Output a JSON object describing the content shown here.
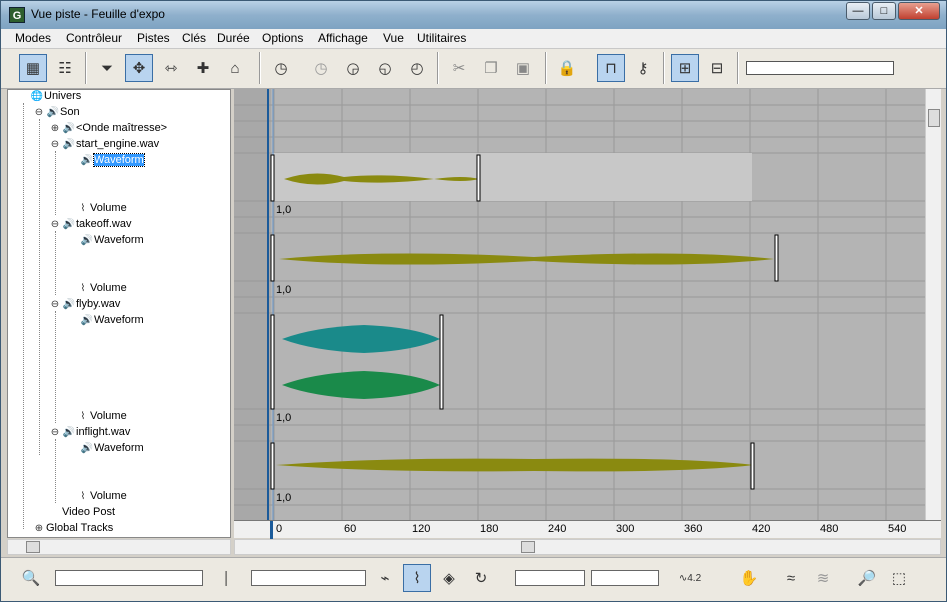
{
  "window": {
    "title": "Vue piste - Feuille d'expo",
    "app_icon": "G",
    "buttons": [
      "—",
      "□",
      "✕"
    ]
  },
  "menu": [
    "Modes",
    "Contrôleur",
    "Pistes",
    "Clés",
    "Durée",
    "Options",
    "Affichage",
    "Vue",
    "Utilitaires"
  ],
  "toolbar": {
    "icons": [
      "filter-icon",
      "edit-keys-icon",
      "filters-funnel-icon",
      "move-keys-icon",
      "slide-keys-icon",
      "add-keys-icon",
      "scale-keys-icon",
      "insert-time-icon",
      "select-time-icon",
      "delete-time-icon",
      "reverse-time-icon",
      "scale-time-icon",
      "cut-icon",
      "copy-icon",
      "paste-icon",
      "lock-selection-icon",
      "snap-frames-icon",
      "show-keyable-icon",
      "modify-subtree-icon",
      "modify-child-keys-icon"
    ]
  },
  "tree": {
    "items": [
      {
        "label": "Univers",
        "icon": "globe-icon"
      },
      {
        "label": "Son",
        "icon": "speaker-icon"
      },
      {
        "label": "<Onde maîtresse>",
        "icon": "speaker-icon"
      },
      {
        "label": "start_engine.wav",
        "icon": "speaker-icon"
      },
      {
        "label": "Waveform",
        "icon": "speaker-icon"
      },
      {
        "label": "Volume",
        "icon": "curve-icon"
      },
      {
        "label": "takeoff.wav",
        "icon": "speaker-icon"
      },
      {
        "label": "Waveform",
        "icon": "speaker-icon"
      },
      {
        "label": "Volume",
        "icon": "curve-icon"
      },
      {
        "label": "flyby.wav",
        "icon": "speaker-icon"
      },
      {
        "label": "Waveform",
        "icon": "speaker-icon"
      },
      {
        "label": "Volume",
        "icon": "curve-icon"
      },
      {
        "label": "inflight.wav",
        "icon": "speaker-icon"
      },
      {
        "label": "Waveform",
        "icon": "speaker-icon"
      },
      {
        "label": "Volume",
        "icon": "curve-icon"
      },
      {
        "label": "Video Post",
        "icon": ""
      },
      {
        "label": "Global Tracks",
        "icon": ""
      }
    ],
    "selected": "Waveform"
  },
  "tracks": {
    "volume_label": "1,0",
    "olive": "#8a8a10",
    "teal": "#1a8a8a",
    "green": "#1a8a4a"
  },
  "ruler": {
    "ticks": [
      "0",
      "60",
      "120",
      "180",
      "240",
      "300",
      "360",
      "420",
      "480",
      "540"
    ]
  },
  "bottom": {
    "icons": [
      "zoom-selected-icon",
      "select-by-name-icon",
      "key-mode-icon",
      "snap-icon",
      "show-tangents-icon",
      "lock-tangents-icon",
      "value-icon",
      "pan-icon",
      "zoom-horizontal-icon",
      "zoom-value-icon",
      "zoom-icon",
      "zoom-region-icon"
    ],
    "value_label": "4.2"
  }
}
